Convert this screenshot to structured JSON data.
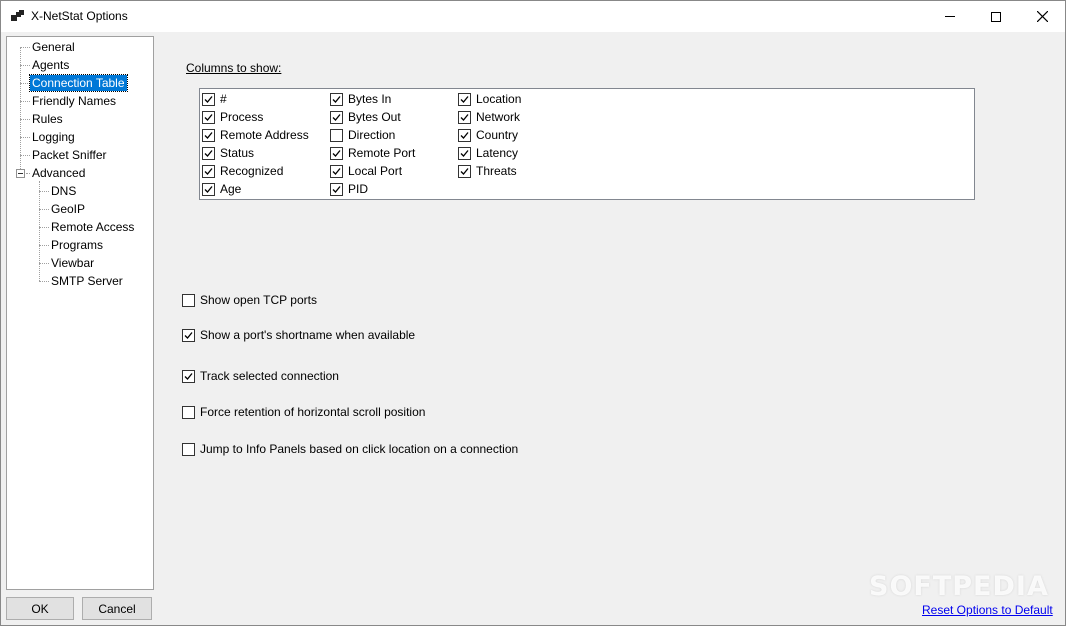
{
  "window": {
    "title": "X-NetStat Options"
  },
  "tree": {
    "items": [
      {
        "label": "General"
      },
      {
        "label": "Agents"
      },
      {
        "label": "Connection Table"
      },
      {
        "label": "Friendly Names"
      },
      {
        "label": "Rules"
      },
      {
        "label": "Logging"
      },
      {
        "label": "Packet Sniffer"
      },
      {
        "label": "Advanced"
      }
    ],
    "advanced_children": [
      {
        "label": "DNS"
      },
      {
        "label": "GeoIP"
      },
      {
        "label": "Remote Access"
      },
      {
        "label": "Programs"
      },
      {
        "label": "Viewbar"
      },
      {
        "label": "SMTP Server"
      }
    ],
    "selected": "Connection Table"
  },
  "columns": {
    "label": "Columns to show:",
    "col1": [
      {
        "label": "#",
        "checked": true
      },
      {
        "label": "Process",
        "checked": true
      },
      {
        "label": "Remote Address",
        "checked": true
      },
      {
        "label": "Status",
        "checked": true
      },
      {
        "label": "Recognized",
        "checked": true
      },
      {
        "label": "Age",
        "checked": true
      }
    ],
    "col2": [
      {
        "label": "Bytes In",
        "checked": true
      },
      {
        "label": "Bytes Out",
        "checked": true
      },
      {
        "label": "Direction",
        "checked": false
      },
      {
        "label": "Remote Port",
        "checked": true
      },
      {
        "label": "Local Port",
        "checked": true
      },
      {
        "label": "PID",
        "checked": true
      }
    ],
    "col3": [
      {
        "label": "Location",
        "checked": true
      },
      {
        "label": "Network",
        "checked": true
      },
      {
        "label": "Country",
        "checked": true
      },
      {
        "label": "Latency",
        "checked": true
      },
      {
        "label": "Threats",
        "checked": true
      }
    ]
  },
  "options": [
    {
      "label": "Show open TCP ports",
      "checked": false
    },
    {
      "label": "Show a port's shortname when available",
      "checked": true
    },
    {
      "label": "Track selected connection",
      "checked": true
    },
    {
      "label": "Force retention of horizontal scroll position",
      "checked": false
    },
    {
      "label": "Jump to Info Panels based on click location on a connection",
      "checked": false
    }
  ],
  "buttons": {
    "ok": "OK",
    "cancel": "Cancel"
  },
  "reset_link": "Reset Options to Default",
  "watermark": "SOFTPEDIA",
  "colors": {
    "selection": "#0078d7",
    "link": "#0000ee"
  }
}
